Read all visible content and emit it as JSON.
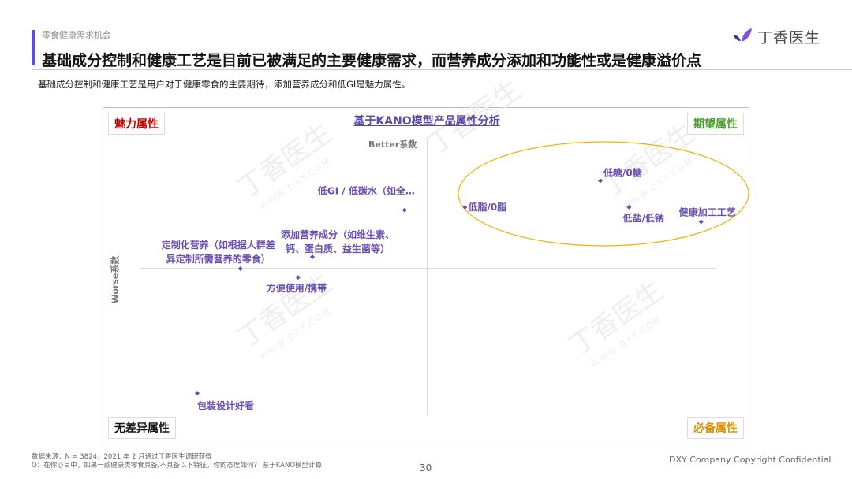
{
  "header": {
    "section_label": "零食健康需求机会",
    "title": "基础成分控制和健康工艺是目前已被满足的主要健康需求，而营养成分添加和功能性或是健康溢价点",
    "subtitle": "基础成分控制和健康工艺是用户对于健康零食的主要期待，添加营养成分和低GI是魅力属性。"
  },
  "logo": {
    "text": "丁香医生",
    "color": "#6b3fd6"
  },
  "watermark": {
    "text": "丁香医生",
    "sub": "WWW.DXY.COM"
  },
  "chart_data": {
    "type": "scatter",
    "title": "基于KANO模型产品属性分析",
    "xlabel": "Worse系数",
    "ylabel": "Better系数",
    "quadrants": {
      "top_left": "魅力属性",
      "top_right": "期望属性",
      "bottom_left": "无差异属性",
      "bottom_right": "必备属性"
    },
    "quadrant_colors": {
      "top_left": "#c00000",
      "top_right": "#4a9d2c",
      "bottom_left": "#111111",
      "bottom_right": "#e08a00"
    },
    "highlight_color": "#f0b400",
    "points": [
      {
        "name": "低糖/0糖",
        "x": 0.6,
        "y": 0.6,
        "label_lines": [
          "低糖/0糖"
        ]
      },
      {
        "name": "低脂/0脂",
        "x": 0.13,
        "y": 0.42,
        "label_lines": [
          "低脂/0脂"
        ]
      },
      {
        "name": "低盐/低钠",
        "x": 0.7,
        "y": 0.42,
        "label_lines": [
          "低盐/低钠"
        ]
      },
      {
        "name": "健康加工工艺",
        "x": 0.95,
        "y": 0.32,
        "label_lines": [
          "健康加工工艺"
        ]
      },
      {
        "name": "低GI / 低碳水（如全…",
        "x": -0.08,
        "y": 0.4,
        "label_lines": [
          "低GI / 低碳水（如全…"
        ]
      },
      {
        "name": "添加营养成分（如维生素、钙、蛋白质、益生菌等）",
        "x": -0.4,
        "y": 0.08,
        "label_lines": [
          "添加营养成分（如维生素、",
          "钙、蛋白质、益生菌等）"
        ]
      },
      {
        "name": "定制化营养（如根据人群差异定制所需营养的零食）",
        "x": -0.65,
        "y": 0.0,
        "label_lines": [
          "定制化营养（如根据人群差",
          "异定制所需营养的零食）"
        ]
      },
      {
        "name": "方便使用/携带",
        "x": -0.45,
        "y": -0.06,
        "label_lines": [
          "方便使用/携带"
        ]
      },
      {
        "name": "包装设计好看",
        "x": -0.8,
        "y": -0.85,
        "label_lines": [
          "包装设计好看"
        ]
      }
    ]
  },
  "footer": {
    "source_line1": "数据来源：N = 3824；2021 年 2 月通过丁香医生调研获得",
    "source_line2": "Q：在你心目中，如果一款健康类零食具备/不具备以下特征，你的态度如何？ 基于KANO模型计算",
    "page_number": "30",
    "copyright": "DXY Company Copyright Confidential"
  }
}
